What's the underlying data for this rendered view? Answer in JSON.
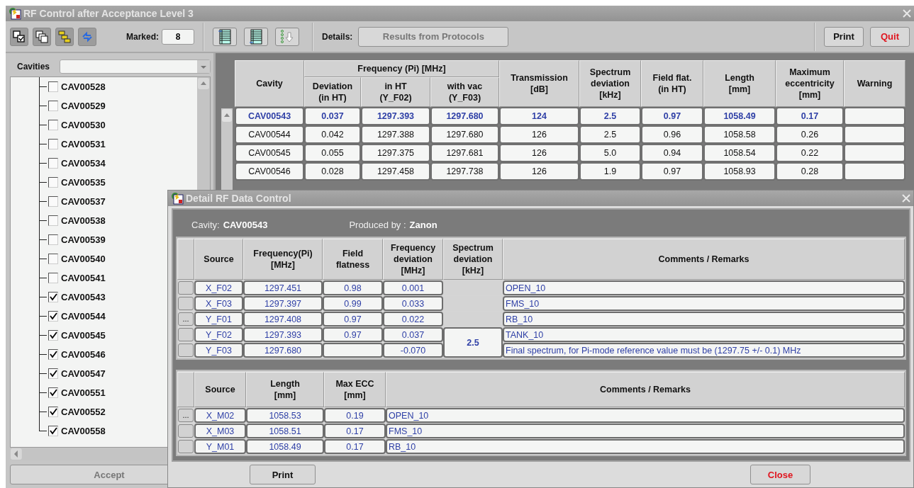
{
  "window": {
    "title": "RF Control after Acceptance Level 3"
  },
  "toolbar": {
    "marked_label": "Marked:",
    "marked_value": "8",
    "details_label": "Details:",
    "details_button": "Results from Protocols",
    "print": "Print",
    "quit": "Quit"
  },
  "cavities_panel": {
    "label": "Cavities",
    "accept": "Accept",
    "items": [
      {
        "name": "CAV00528",
        "checked": false
      },
      {
        "name": "CAV00529",
        "checked": false
      },
      {
        "name": "CAV00530",
        "checked": false
      },
      {
        "name": "CAV00531",
        "checked": false
      },
      {
        "name": "CAV00534",
        "checked": false
      },
      {
        "name": "CAV00535",
        "checked": false
      },
      {
        "name": "CAV00537",
        "checked": false
      },
      {
        "name": "CAV00538",
        "checked": false
      },
      {
        "name": "CAV00539",
        "checked": false
      },
      {
        "name": "CAV00540",
        "checked": false
      },
      {
        "name": "CAV00541",
        "checked": false
      },
      {
        "name": "CAV00543",
        "checked": true
      },
      {
        "name": "CAV00544",
        "checked": true
      },
      {
        "name": "CAV00545",
        "checked": true
      },
      {
        "name": "CAV00546",
        "checked": true
      },
      {
        "name": "CAV00547",
        "checked": true
      },
      {
        "name": "CAV00551",
        "checked": true
      },
      {
        "name": "CAV00552",
        "checked": true
      },
      {
        "name": "CAV00558",
        "checked": true
      }
    ]
  },
  "table": {
    "header_rows": [
      [
        {
          "label": "Cavity",
          "rowspan": 2
        },
        {
          "label": "Frequency (Pi) [MHz]",
          "colspan": 3
        },
        {
          "label": "Transmission\n[dB]",
          "rowspan": 2
        },
        {
          "label": "Spectrum\ndeviation\n[kHz]",
          "rowspan": 2
        },
        {
          "label": "Field flat.\n(in HT)",
          "rowspan": 2
        },
        {
          "label": "Length\n[mm]",
          "rowspan": 2
        },
        {
          "label": "Maximum\neccentricity\n[mm]",
          "rowspan": 2
        },
        {
          "label": "Warning",
          "rowspan": 2
        }
      ],
      [
        {
          "label": "Deviation\n(in HT)"
        },
        {
          "label": "in HT\n(Y_F02)"
        },
        {
          "label": "with vac\n(Y_F03)"
        }
      ]
    ],
    "rows": [
      {
        "selected": true,
        "cells": [
          "CAV00543",
          "0.037",
          "1297.393",
          "1297.680",
          "124",
          "2.5",
          "0.97",
          "1058.49",
          "0.17"
        ]
      },
      {
        "selected": false,
        "cells": [
          "CAV00544",
          "0.042",
          "1297.388",
          "1297.680",
          "126",
          "2.5",
          "0.96",
          "1058.58",
          "0.26"
        ]
      },
      {
        "selected": false,
        "cells": [
          "CAV00545",
          "0.055",
          "1297.375",
          "1297.681",
          "126",
          "5.0",
          "0.94",
          "1058.54",
          "0.22"
        ]
      },
      {
        "selected": false,
        "cells": [
          "CAV00546",
          "0.028",
          "1297.458",
          "1297.738",
          "126",
          "1.9",
          "0.97",
          "1058.93",
          "0.28"
        ]
      }
    ]
  },
  "detail": {
    "title": "Detail RF Data Control",
    "cavity_label": "Cavity:",
    "cavity": "CAV00543",
    "produced_label": "Produced by :",
    "producer": "Zanon",
    "frequency_table": {
      "columns": [
        "Source",
        "Frequency(Pi)\n[MHz]",
        "Field\nflatness",
        "Frequency\ndeviation\n[MHz]",
        "Spectrum\ndeviation\n[kHz]",
        "Comments / Remarks"
      ],
      "rows": [
        {
          "source": "X_F02",
          "frequency": "1297.451",
          "field_flatness": "0.98",
          "frequency_deviation": "0.001",
          "comment": "OPEN_10"
        },
        {
          "source": "X_F03",
          "frequency": "1297.397",
          "field_flatness": "0.99",
          "frequency_deviation": "0.033",
          "comment": "FMS_10"
        },
        {
          "button_label": "...",
          "source": "Y_F01",
          "frequency": "1297.408",
          "field_flatness": "0.97",
          "frequency_deviation": "0.022",
          "comment": "RB_10"
        },
        {
          "source": "Y_F02",
          "frequency": "1297.393",
          "field_flatness": "0.97",
          "frequency_deviation": "0.037",
          "spectrum_deviation": "2.5",
          "comment": "TANK_10"
        },
        {
          "source": "Y_F03",
          "frequency": "1297.680",
          "frequency_deviation": "-0.070",
          "spectrum_merged": true,
          "comment": "Final spectrum, for Pi-mode reference value must be (1297.75 +/- 0.1) MHz"
        }
      ]
    },
    "length_table": {
      "columns": [
        "Source",
        "Length\n[mm]",
        "Max ECC\n[mm]",
        "Comments / Remarks"
      ],
      "rows": [
        {
          "button_label": "...",
          "source": "X_M02",
          "length": "1058.53",
          "max_ecc": "0.19",
          "comment": "OPEN_10"
        },
        {
          "source": "X_M03",
          "length": "1058.51",
          "max_ecc": "0.17",
          "comment": "FMS_10"
        },
        {
          "source": "Y_M01",
          "length": "1058.49",
          "max_ecc": "0.17",
          "comment": "RB_10"
        }
      ]
    },
    "print": "Print",
    "close": "Close"
  }
}
